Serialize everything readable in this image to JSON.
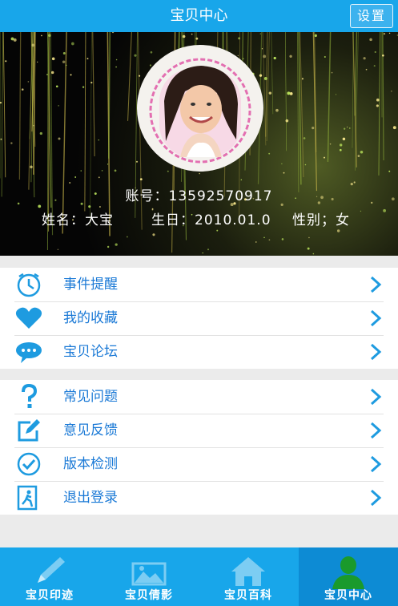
{
  "header": {
    "title": "宝贝中心",
    "settings_label": "设置"
  },
  "profile": {
    "account": "账号：13592570917",
    "name": "姓名：大宝",
    "birthday": "生日：2010.01.0",
    "gender": "性别；女"
  },
  "menu_group_1": [
    {
      "label": "事件提醒",
      "icon": "clock-icon"
    },
    {
      "label": "我的收藏",
      "icon": "heart-icon"
    },
    {
      "label": "宝贝论坛",
      "icon": "chat-bubble-icon"
    }
  ],
  "menu_group_2": [
    {
      "label": "常见问题",
      "icon": "question-icon"
    },
    {
      "label": "意见反馈",
      "icon": "edit-icon"
    },
    {
      "label": "版本检测",
      "icon": "check-circle-icon"
    },
    {
      "label": "退出登录",
      "icon": "exit-icon"
    }
  ],
  "tabs": [
    {
      "label": "宝贝印迹",
      "icon": "pencil-icon"
    },
    {
      "label": "宝贝倩影",
      "icon": "image-icon"
    },
    {
      "label": "宝贝百科",
      "icon": "home-icon"
    },
    {
      "label": "宝贝中心",
      "icon": "user-icon",
      "active": true
    }
  ],
  "colors": {
    "brand": "#18a6ea",
    "label": "#1a79d6",
    "active_tab": "#0d8bd4"
  }
}
